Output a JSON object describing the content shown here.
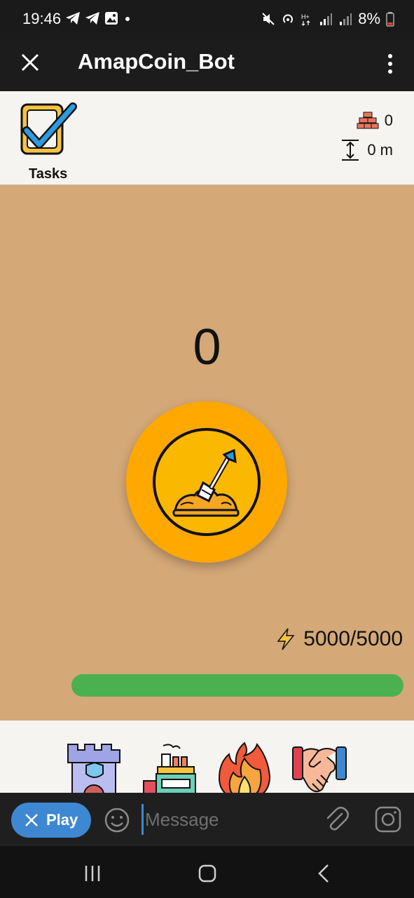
{
  "status_bar": {
    "time": "19:46",
    "battery": "8%",
    "notification_icons": [
      "telegram-icon",
      "telegram-icon",
      "gallery-icon",
      "dot-icon"
    ],
    "system_icons": [
      "mute-icon",
      "hotspot-icon",
      "network-h-plus-icon",
      "signal-icon",
      "signal-icon",
      "battery-low-icon"
    ]
  },
  "app_bar": {
    "title": "AmapCoin_Bot",
    "close_icon": "close-icon",
    "menu_icon": "more-vertical-icon"
  },
  "header": {
    "tasks_label": "Tasks",
    "bricks_count": "0",
    "depth": "0 m"
  },
  "game": {
    "score": "0",
    "energy": "5000/5000",
    "energy_level": 1.0,
    "colors": {
      "background": "#d4a877",
      "coin": "#fea800",
      "energy_bar": "#4bb050"
    }
  },
  "bottom_nav": {
    "items": [
      "castle-icon",
      "factory-icon",
      "fire-icon",
      "handshake-icon"
    ]
  },
  "input_bar": {
    "play_label": "Play",
    "placeholder": "Message"
  }
}
